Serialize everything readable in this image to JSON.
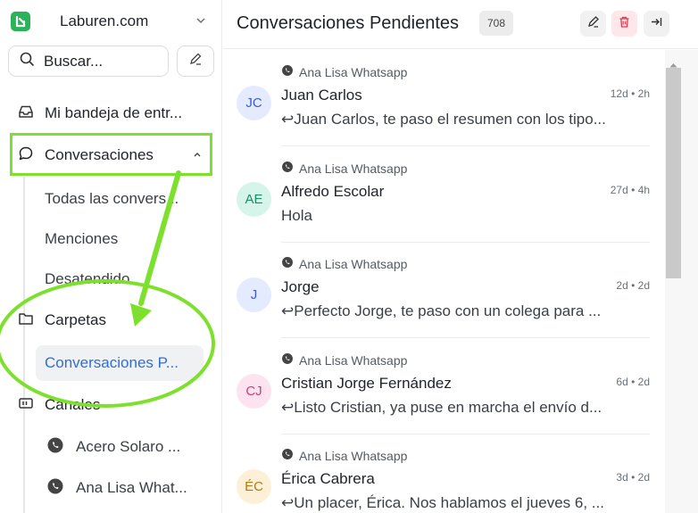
{
  "sidebar": {
    "brand": "Laburen.com",
    "search_placeholder": "Buscar...",
    "inbox_label": "Mi bandeja de entr...",
    "conversations_label": "Conversaciones",
    "sub_items": [
      "Todas las convers...",
      "Menciones",
      "Desatendido"
    ],
    "folders_label": "Carpetas",
    "active_folder": "Conversaciones P...",
    "channels_label": "Canales",
    "channels": [
      "Acero Solaro ...",
      "Ana Lisa What..."
    ]
  },
  "header": {
    "title": "Conversaciones Pendientes",
    "count": "708"
  },
  "conversations": [
    {
      "inbox": "Ana Lisa Whatsapp",
      "initials": "JC",
      "name": "Juan Carlos",
      "time": "12d • 2h",
      "preview": "↩Juan Carlos, te paso el resumen con los tipo...",
      "avatar_bg": "#e5ebff",
      "avatar_fg": "#3f5bd1"
    },
    {
      "inbox": "Ana Lisa Whatsapp",
      "initials": "AE",
      "name": "Alfredo Escolar",
      "time": "27d • 4h",
      "preview": "Hola",
      "avatar_bg": "#d5f5ea",
      "avatar_fg": "#1f8a64"
    },
    {
      "inbox": "Ana Lisa Whatsapp",
      "initials": "J",
      "name": "Jorge",
      "time": "2d • 2d",
      "preview": "↩Perfecto Jorge, te paso con un colega para ...",
      "avatar_bg": "#e5ebff",
      "avatar_fg": "#3f5bd1"
    },
    {
      "inbox": "Ana Lisa Whatsapp",
      "initials": "CJ",
      "name": "Cristian Jorge Fernández",
      "time": "6d • 2d",
      "preview": "↩Listo Cristian, ya puse en marcha el envío d...",
      "avatar_bg": "#fde3ef",
      "avatar_fg": "#c8407e"
    },
    {
      "inbox": "Ana Lisa Whatsapp",
      "initials": "ÉC",
      "name": "Érica Cabrera",
      "time": "3d • 2d",
      "preview": "↩Un placer, Érica. Nos hablamos el jueves 6, ...",
      "avatar_bg": "#fdf0d6",
      "avatar_fg": "#b07a12"
    }
  ],
  "colors": {
    "accent_green": "#7ee02e",
    "brand_green": "#2bb35a",
    "active_blue": "#2f6fd4",
    "delete_red": "#e0364f"
  }
}
